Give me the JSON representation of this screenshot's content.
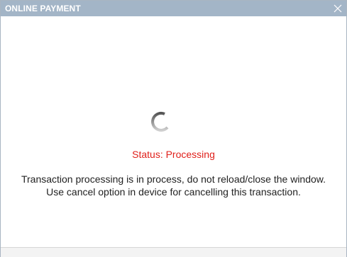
{
  "dialog": {
    "title": "ONLINE PAYMENT",
    "close_icon": "close-icon"
  },
  "status": {
    "label": "Status: Processing",
    "color": "#e0201b",
    "spinner_icon": "loading-spinner-icon"
  },
  "message": {
    "line1": "Transaction processing is in process, do not reload/close the window.",
    "line2": "Use cancel option in device for cancelling this transaction."
  },
  "colors": {
    "title_bar": "#a3b5c7",
    "border": "#a9b5c2"
  }
}
